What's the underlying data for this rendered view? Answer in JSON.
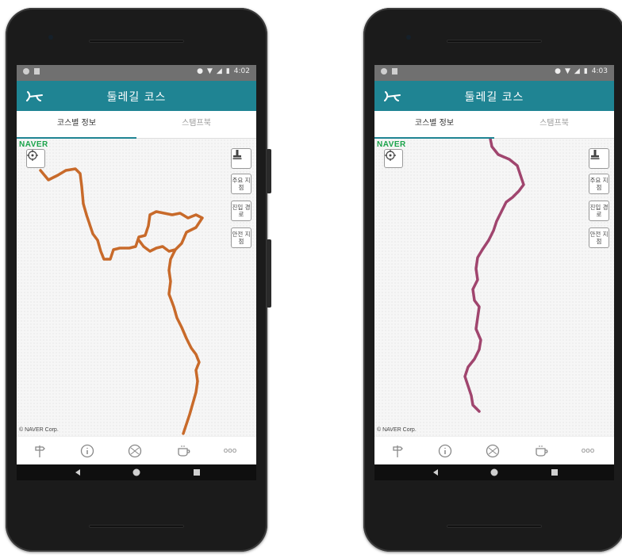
{
  "screens": [
    {
      "status": {
        "time": "4:02"
      },
      "app_title": "둘레길 코스",
      "tabs": [
        "코스별 정보",
        "스탬프북"
      ],
      "map": {
        "brand": "NAVER",
        "copyright": "© NAVER Corp.",
        "buttons": [
          "주요 지점",
          "진입 경로",
          "안전 지점"
        ],
        "route_color": "#c86a2a"
      },
      "bottom_nav": {
        "more": "ooo"
      }
    },
    {
      "status": {
        "time": "4:03"
      },
      "app_title": "둘레길 코스",
      "tabs": [
        "코스별 정보",
        "스탬프북"
      ],
      "map": {
        "brand": "NAVER",
        "copyright": "© NAVER Corp.",
        "buttons": [
          "주요 지점",
          "진입 경로",
          "안전 지점"
        ],
        "route_color": "#a0456e"
      },
      "bottom_nav": {
        "more": "ooo"
      }
    }
  ],
  "colors": {
    "appbar": "#1f8493",
    "status_bar": "#707070"
  },
  "icons": [
    "signpost-icon",
    "info-icon",
    "ball-icon",
    "cafe-icon",
    "more-icon",
    "locate-icon",
    "stamp-icon",
    "back-icon",
    "home-icon",
    "recents-icon"
  ]
}
